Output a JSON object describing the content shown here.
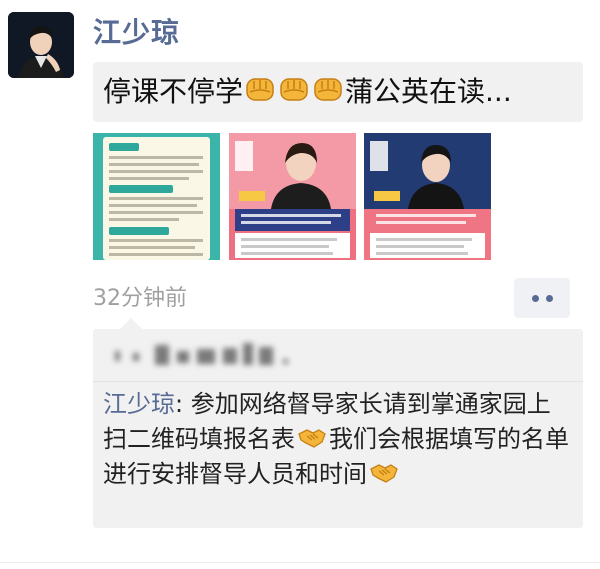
{
  "post": {
    "author": "江少琼",
    "text_before": "停课不停学",
    "text_after": "蒲公英在读...",
    "time": "32分钟前",
    "images": [
      {
        "icon": "poster-tips-icon"
      },
      {
        "icon": "poster-teacher-icon"
      },
      {
        "icon": "poster-teacher-icon"
      }
    ]
  },
  "comments": [
    {
      "author": "江少琼",
      "separator": ": ",
      "text_1": "参加网络督导家长请到掌通家园上扫二维码填报名表",
      "text_2": "我们会根据填写的名单进行安排督导人员和时间"
    }
  ],
  "colors": {
    "name": "#576b95",
    "bubble": "#f1f1f1",
    "time": "#a0a0a0"
  }
}
